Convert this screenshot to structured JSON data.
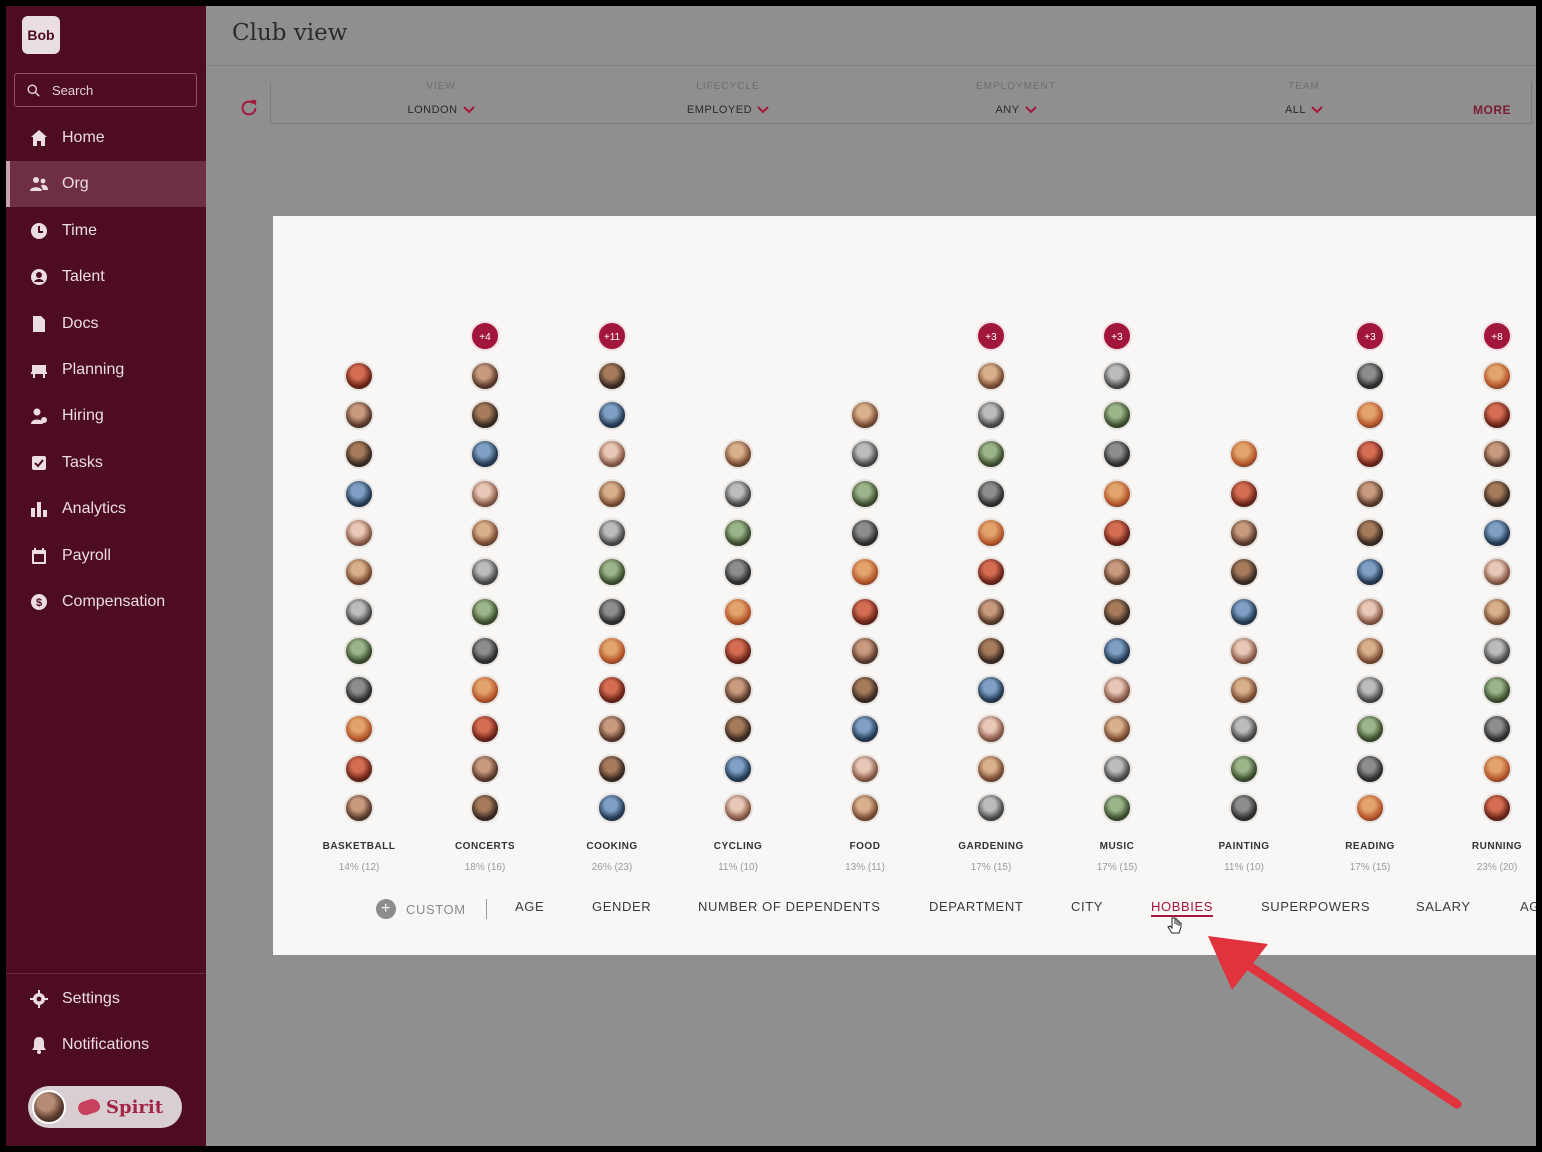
{
  "app": {
    "logo": "Bob",
    "page_title": "Club view"
  },
  "search": {
    "placeholder": "Search"
  },
  "nav": [
    {
      "label": "Home",
      "icon": "home-icon"
    },
    {
      "label": "Org",
      "icon": "people-icon",
      "active": true
    },
    {
      "label": "Time",
      "icon": "clock-icon"
    },
    {
      "label": "Talent",
      "icon": "talent-icon"
    },
    {
      "label": "Docs",
      "icon": "document-icon"
    },
    {
      "label": "Planning",
      "icon": "planning-icon"
    },
    {
      "label": "Hiring",
      "icon": "hiring-icon"
    },
    {
      "label": "Tasks",
      "icon": "checkbox-icon"
    },
    {
      "label": "Analytics",
      "icon": "bar-chart-icon"
    },
    {
      "label": "Payroll",
      "icon": "calendar-icon"
    },
    {
      "label": "Compensation",
      "icon": "dollar-icon"
    }
  ],
  "nav_bottom": [
    {
      "label": "Settings",
      "icon": "gear-icon"
    },
    {
      "label": "Notifications",
      "icon": "bell-icon"
    }
  ],
  "spirit": {
    "label": "Spirit"
  },
  "filters": [
    {
      "label": "VIEW",
      "value": "LONDON"
    },
    {
      "label": "LIFECYCLE",
      "value": "EMPLOYED"
    },
    {
      "label": "EMPLOYMENT",
      "value": "ANY"
    },
    {
      "label": "TEAM",
      "value": "ALL"
    }
  ],
  "more_label": "MORE",
  "clubs": [
    {
      "name": "BASKETBALL",
      "stat": "14% (12)",
      "count": 12,
      "extra": ""
    },
    {
      "name": "CONCERTS",
      "stat": "18% (16)",
      "count": 12,
      "extra": "+4"
    },
    {
      "name": "COOKING",
      "stat": "26% (23)",
      "count": 12,
      "extra": "+11"
    },
    {
      "name": "CYCLING",
      "stat": "11% (10)",
      "count": 10,
      "extra": ""
    },
    {
      "name": "FOOD",
      "stat": "13% (11)",
      "count": 11,
      "extra": ""
    },
    {
      "name": "GARDENING",
      "stat": "17% (15)",
      "count": 12,
      "extra": "+3"
    },
    {
      "name": "MUSIC",
      "stat": "17% (15)",
      "count": 12,
      "extra": "+3"
    },
    {
      "name": "PAINTING",
      "stat": "11% (10)",
      "count": 10,
      "extra": ""
    },
    {
      "name": "READING",
      "stat": "17% (15)",
      "count": 12,
      "extra": "+3"
    },
    {
      "name": "RUNNING",
      "stat": "23% (20)",
      "count": 12,
      "extra": "+8"
    }
  ],
  "tabs": {
    "custom": "CUSTOM",
    "items": [
      "AGE",
      "GENDER",
      "NUMBER OF DEPENDENTS",
      "DEPARTMENT",
      "CITY",
      "HOBBIES",
      "SUPERPOWERS",
      "SALARY",
      "AG"
    ],
    "active": "HOBBIES"
  },
  "colors": {
    "sidebar": "#4d0c20",
    "accent": "#a5163d",
    "arrow": "#e0333d"
  }
}
